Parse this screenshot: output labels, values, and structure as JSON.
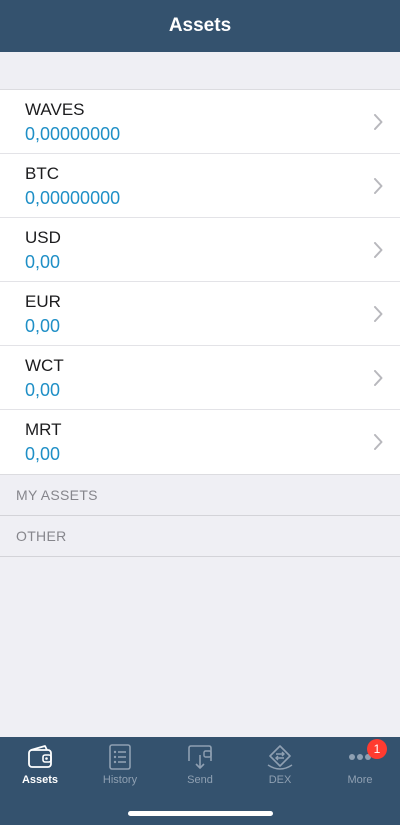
{
  "header": {
    "title": "Assets"
  },
  "assets": [
    {
      "name": "WAVES",
      "balance": "0,00000000"
    },
    {
      "name": "BTC",
      "balance": "0,00000000"
    },
    {
      "name": "USD",
      "balance": "0,00"
    },
    {
      "name": "EUR",
      "balance": "0,00"
    },
    {
      "name": "WCT",
      "balance": "0,00"
    },
    {
      "name": "MRT",
      "balance": "0,00"
    }
  ],
  "sections": {
    "my_assets": "MY ASSETS",
    "other": "OTHER"
  },
  "tabbar": {
    "tabs": [
      {
        "label": "Assets",
        "icon": "wallet-icon",
        "active": true
      },
      {
        "label": "History",
        "icon": "list-icon"
      },
      {
        "label": "Send",
        "icon": "send-icon"
      },
      {
        "label": "DEX",
        "icon": "dex-icon"
      },
      {
        "label": "More",
        "icon": "more-icon",
        "badge": "1"
      }
    ]
  },
  "colors": {
    "navbar": "#34526e",
    "balance": "#1f8fc6",
    "badge": "#ff3b30",
    "background": "#efeff4"
  }
}
